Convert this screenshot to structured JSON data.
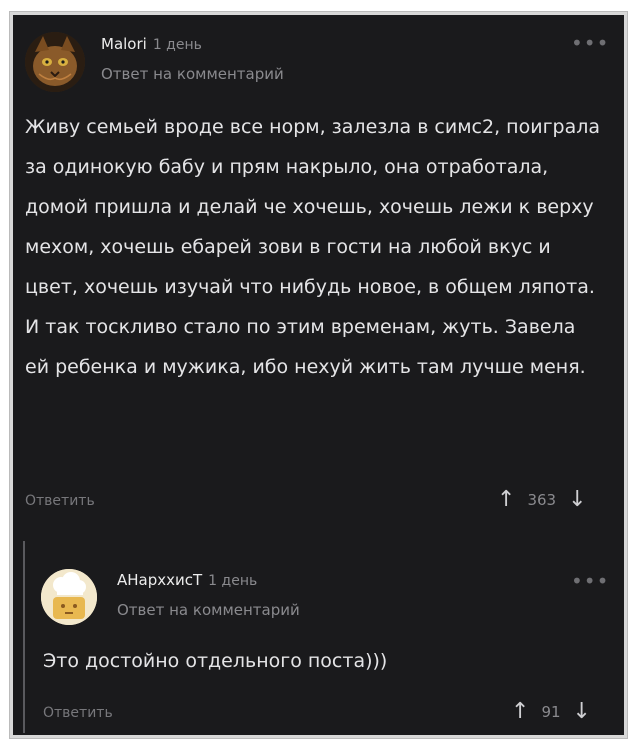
{
  "comments": [
    {
      "author": "Malori",
      "time": "1 день",
      "reply_to": "Ответ на комментарий",
      "more_label": "•••",
      "text": "Живу семьей вроде все норм, залезла в симс2, поиграла за одинокую бабу и прям накрыло, она отработала, домой пришла и делай че хочешь, хочешь лежи к верху мехом, хочешь ебарей зови в гости на любой вкус и цвет, хочешь изучай что нибудь новое, в общем ляпота. И так тоскливо стало по этим временам, жуть. Завела ей ребенка и мужика, ибо нехуй жить там лучше меня.",
      "reply_label": "Ответить",
      "up_icon": "↑",
      "down_icon": "↓",
      "votes": "363"
    },
    {
      "author": "АНархxисТ",
      "time": "1 день",
      "reply_to": "Ответ на комментарий",
      "more_label": "•••",
      "text": "Это достойно отдельного поста)))",
      "reply_label": "Ответить",
      "up_icon": "↑",
      "down_icon": "↓",
      "votes": "91"
    }
  ],
  "colors": {
    "background": "#1a1a1c",
    "text": "#e4e4e6",
    "muted": "#8a8a8e"
  }
}
